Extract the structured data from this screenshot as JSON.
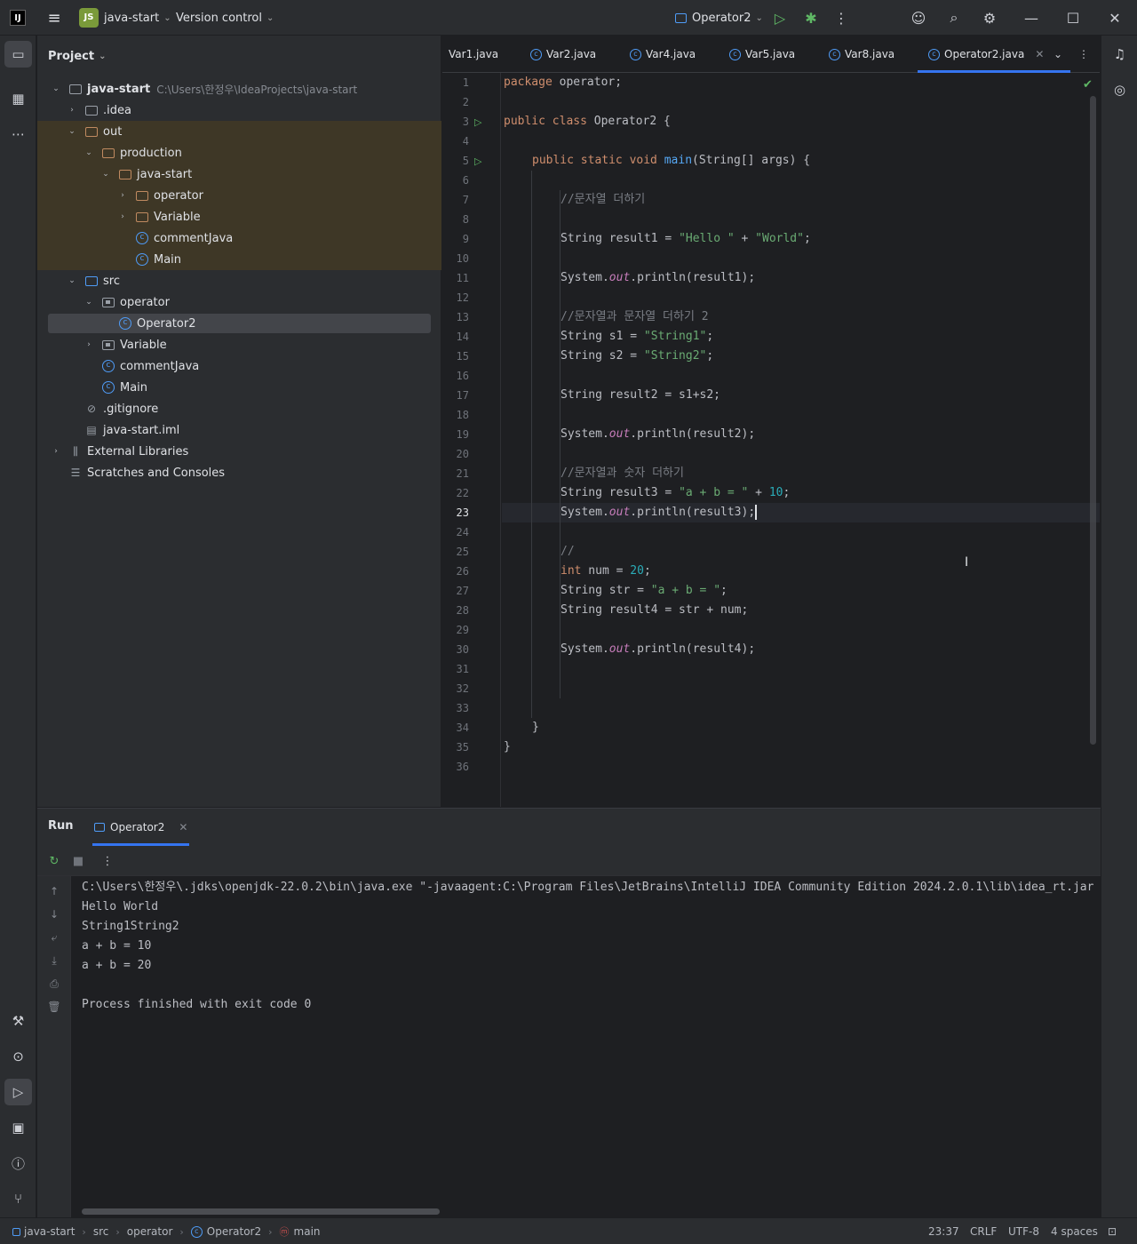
{
  "titlebar": {
    "logo": "IJ",
    "project_badge": "JS",
    "project_name": "java-start",
    "version_control": "Version control",
    "run_config": "Operator2"
  },
  "project_panel": {
    "title": "Project",
    "root_name": "java-start",
    "root_path": "C:\\Users\\한정우\\IdeaProjects\\java-start",
    "items": [
      {
        "label": ".idea"
      },
      {
        "label": "out"
      },
      {
        "label": "production"
      },
      {
        "label": "java-start"
      },
      {
        "label": "operator"
      },
      {
        "label": "Variable"
      },
      {
        "label": "commentJava"
      },
      {
        "label": "Main"
      },
      {
        "label": "src"
      },
      {
        "label": "operator"
      },
      {
        "label": "Operator2"
      },
      {
        "label": "Variable"
      },
      {
        "label": "commentJava"
      },
      {
        "label": "Main"
      },
      {
        "label": ".gitignore"
      },
      {
        "label": "java-start.iml"
      },
      {
        "label": "External Libraries"
      },
      {
        "label": "Scratches and Consoles"
      }
    ]
  },
  "editor_tabs": [
    {
      "label": "Var1.java"
    },
    {
      "label": "Var2.java"
    },
    {
      "label": "Var4.java"
    },
    {
      "label": "Var5.java"
    },
    {
      "label": "Var8.java"
    },
    {
      "label": "Operator2.java"
    }
  ],
  "editor": {
    "line_numbers": [
      "1",
      "2",
      "3",
      "4",
      "5",
      "6",
      "7",
      "8",
      "9",
      "10",
      "11",
      "12",
      "13",
      "14",
      "15",
      "16",
      "17",
      "18",
      "19",
      "20",
      "21",
      "22",
      "23",
      "24",
      "25",
      "26",
      "27",
      "28",
      "29",
      "30",
      "31",
      "32",
      "33",
      "34",
      "35",
      "36"
    ],
    "code": {
      "l1_kw": "package",
      "l1_rest": " operator;",
      "l3_kw": "public class",
      "l3_rest": " Operator2 {",
      "l5_kw": "public static void",
      "l5_fn": "main",
      "l5_rest": "(String[] args) {",
      "l7": "//문자열 더하기",
      "l9_a": "String result1 = ",
      "l9_s1": "\"Hello \"",
      "l9_b": " + ",
      "l9_s2": "\"World\"",
      "l9_c": ";",
      "sys": "System.",
      "out": "out",
      "l11_rest": ".println(result1);",
      "l13": "//문자열과 문자열 더하기 2",
      "l14_a": "String s1 = ",
      "l14_s": "\"String1\"",
      "semi": ";",
      "l15_a": "String s2 = ",
      "l15_s": "\"String2\"",
      "l17": "String result2 = s1+s2;",
      "l19_rest": ".println(result2);",
      "l21": "//문자열과 숫자 더하기",
      "l22_a": "String result3 = ",
      "l22_s": "\"a + b = \"",
      "l22_b": " + ",
      "l22_n": "10",
      "l23_rest": ".println(result3);",
      "l25": "//",
      "l26_kw": "int",
      "l26_a": " num = ",
      "l26_n": "20",
      "l27_a": "String str = ",
      "l27_s": "\"a + b = \"",
      "l28": "String result4 = str + num;",
      "l30_rest": ".println(result4);",
      "close_brace": "}"
    }
  },
  "run_panel": {
    "title": "Run",
    "tab_label": "Operator2",
    "console": [
      "C:\\Users\\한정우\\.jdks\\openjdk-22.0.2\\bin\\java.exe \"-javaagent:C:\\Program Files\\JetBrains\\IntelliJ IDEA Community Edition 2024.2.0.1\\lib\\idea_rt.jar",
      "Hello World",
      "String1String2",
      "a + b = 10",
      "a + b = 20",
      "",
      "Process finished with exit code 0"
    ]
  },
  "statusbar": {
    "crumbs": [
      "java-start",
      "src",
      "operator",
      "Operator2",
      "main"
    ],
    "position": "23:37",
    "line_sep": "CRLF",
    "encoding": "UTF-8",
    "indent": "4 spaces"
  },
  "colors": {
    "accent": "#3574f0",
    "run_green": "#5fb865",
    "excluded_bg": "#3e3726"
  }
}
